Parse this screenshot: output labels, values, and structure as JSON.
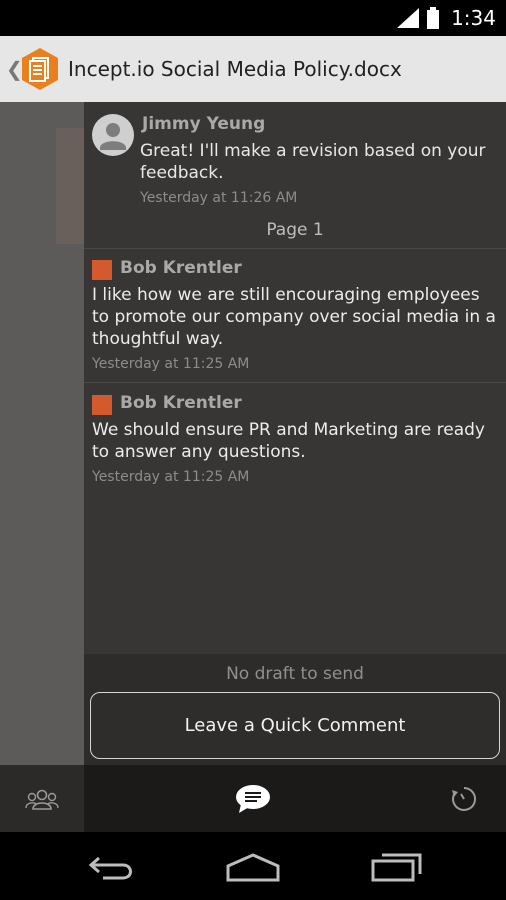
{
  "status_bar": {
    "time": "1:34"
  },
  "header": {
    "title": "Incept.io Social Media Policy.docx"
  },
  "reply": {
    "author": "Jimmy Yeung",
    "text": "Great! I'll make a revision based on your feedback.",
    "time": "Yesterday at 11:26 AM"
  },
  "page_label": "Page 1",
  "comments": [
    {
      "author": "Bob Krentler",
      "text": "I like how we are still encouraging employees to promote our company over social media in a thoughtful way.",
      "time": "Yesterday at 11:25 AM"
    },
    {
      "author": "Bob Krentler",
      "text": "We should ensure PR and Marketing are ready to answer any questions.",
      "time": "Yesterday at 11:25 AM"
    }
  ],
  "draft": {
    "status": "No draft to send",
    "button_label": "Leave a Quick Comment"
  },
  "tabs": [
    "people-icon",
    "comments-icon",
    "history-icon"
  ],
  "nav": [
    "back-icon",
    "home-icon",
    "recents-icon"
  ],
  "colors": {
    "accent": "#d35a2c",
    "logo": "#e8801e"
  }
}
